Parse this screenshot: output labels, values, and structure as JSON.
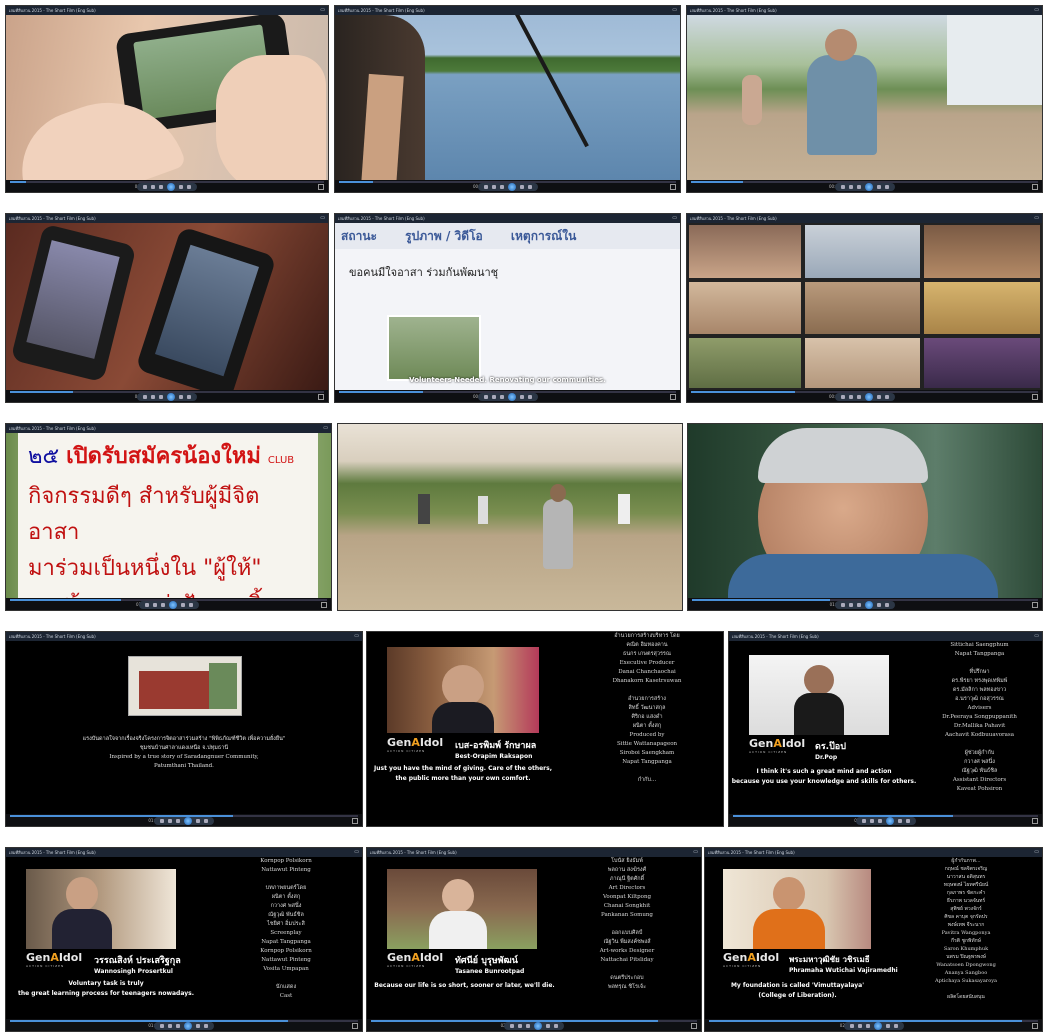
{
  "player": {
    "window_title": "เล่มที่สืบสวน 2015 - The Short Film (Eng Sub)",
    "timestamps": [
      "00:00",
      "00:15",
      "00:21",
      "00:31",
      "00:42",
      "00:52",
      "01:03",
      "01:14",
      "01:25",
      "01:36",
      "01:47",
      "01:58",
      "02:09",
      "02:20",
      "02:31"
    ]
  },
  "frames": {
    "f2_caption": "Volunteers Needed. Renovating our communities.",
    "f2_tab_status": "สถานะ",
    "f2_tab_photo": "รูปภาพ / วิดีโอ",
    "f2_tab_event": "เหตุการณ์ใน",
    "f2_post_text": "ขอคนมีใจอาสา ร่วมกันพัฒนาชุ",
    "sign_line1": "เปิดรับสมัครน้องใหม่",
    "sign_club": "CLUB",
    "sign_line2": "กิจกรรมดีๆ สำหรับผู้มีจิตอาสา",
    "sign_line3": "มาร่วมเป็นหนึ่งใน \"ผู้ให้\"",
    "sign_line4": "มาสร้างและแบ่งปันรอยยิ้ม",
    "sign_num": "๒๕",
    "intro_th1": "แรงบันดาลใจจากเรื่องจริงโครงการจิตอาสาร่วมสร้าง \"พิพิธภัณฑ์ชีวิต เพื่อความยั่งยืน\"",
    "intro_th2": "ชุมชนบ้านศาลาแดงเหนือ จ.ปทุมธานี",
    "intro_en1": "Inspired by a true story of Saradangnuer Community,",
    "intro_en2": "Patumthani Thailand."
  },
  "interviews": [
    {
      "name_th": "เบส-อรพิมพ์ รักษาผล",
      "name_en": "Best-Orapim Raksapon",
      "quote1": "Just you have the mind of giving. Care of the others,",
      "quote2": "the public more than your own comfort.",
      "credits": [
        "อำนวยการสร้างบริหาร โดย",
        "คณิต ฮิมทองคาน",
        "ธนกร เกษตรสุวรรณ",
        "Executive Producer",
        "Danai Chanchaochai",
        "Dhanakorn Kasetrsuwan",
        "",
        "อำนวยการสร้าง",
        "สิทธิ์ วัฒนาสกุล",
        "ศิริกอ แสงดำ",
        "ผนิตา ตั้งสกุ",
        "Produced by",
        "Sittie Wattanapageon",
        "Siroboi Saengkham",
        "Napat Tangpanga",
        "",
        "กำกับ..."
      ]
    },
    {
      "name_th": "ดร.ป๊อป",
      "name_en": "Dr.Pop",
      "quote1": "I think it's such a great mind and action",
      "quote2": "because you use your knowledge and skills for others.",
      "credits": [
        "Sittichai Saengphum",
        "Napat Tangpanga",
        "",
        "ที่ปรึกษา",
        "ดร.พีรยา ทรงพุดเทพิมพ์",
        "ดร.มัลลิกา พลทองขาว",
        "อ.นราวุฒิ กอสุวรรณ",
        "Advisers",
        "Dr.Peeraya Songpuppanith",
        "Dr.Mallika Pahavit",
        "Aachavit Kodbuuavorasa",
        "",
        "ผู้ช่วยผู้กำกับ",
        "กวางศ พสนึ่ง",
        "ณัฐวุฒิ พันธ์ชิล",
        "Assistant Directors",
        "Kaveat Pohsiron"
      ]
    },
    {
      "name_th": "วรรณสิงห์ ประเสริฐกุล",
      "name_en": "Wannosingh Prosertkul",
      "quote1": "Voluntary task is truly",
      "quote2": "the great learning process for teenagers nowadays.",
      "credits": [
        "Kornpop Polsikorn",
        "Nattawut Pinteng",
        "",
        "บทภาพยนตร์โดย",
        "ผนิตา ตั้งสกุ",
        "กวางศ พสนึ่ง",
        "ณัฐวุฒิ พันธ์ชิล",
        "ไชยิศา อิ่มประสิ",
        "Screenplay",
        "Napat Tangpanga",
        "Kornpop Polsikorn",
        "Nattawut Pinteng",
        "Vosita Umpapan",
        "",
        "นักแสดง",
        "Cast"
      ]
    },
    {
      "name_th": "ทัศนีย์ บุรุษพัฒน์",
      "name_en": "Tasanee Bunrootpad",
      "quote1": "Because our life is so short, sooner or later, we'll die.",
      "quote2": "",
      "credits": [
        "โบนัส ยิ่งธัมพ์",
        "พลถาน สงฆิรงศ์",
        "ภาณุนี ฐิตศักดิ์",
        "Art Directors",
        "Voonpat Kiltpong",
        "Chanai Songkhit",
        "Pankanan Somung",
        "",
        "ออกแบบศิลป์",
        "ณัฐวิน พืมสงค์ชพงส์",
        "Art-works Designer",
        "Nattachai Pitsliday",
        "",
        "ดนตรีประกอบ",
        "พลทรุณ ชิโรเจ้ะ"
      ]
    },
    {
      "name_th": "พระมหาวุฒิชัย วชิรเมธี",
      "name_en": "Phramaha Wutichai Vajiramedhi",
      "quote1": "My foundation is called 'Vimuttayalaya'",
      "quote2": "(College of Liberation).",
      "credits": [
        "ผู้กำกับภาพ...",
        "กฤษณ์ ชลจิตรเจริญ",
        "นาวาสน อดิสุนทร",
        "ทฤษพงษ์ ไผทศรีนัยน์",
        "กุลภาพร ขัดกะคำ",
        "ธีรภาพ นวลจันทร์",
        "สุพิชย์ พวงจักร์",
        "ศิขล คาบุต จุกรัดปร",
        "พงษ์เทพ จีระนาก",
        "Pavitra Wangponya",
        "กีรติ ชูกพิทักษ์",
        "Saron Khumphuk",
        "นพรม ปิณฐพรพงษ์",
        "Wanatsoen Dpongwong",
        "Ananya Sangboo",
        "Aptichaya Sukasayaroya",
        "",
        "ผลิตโดยสนับสนุน"
      ]
    }
  ]
}
